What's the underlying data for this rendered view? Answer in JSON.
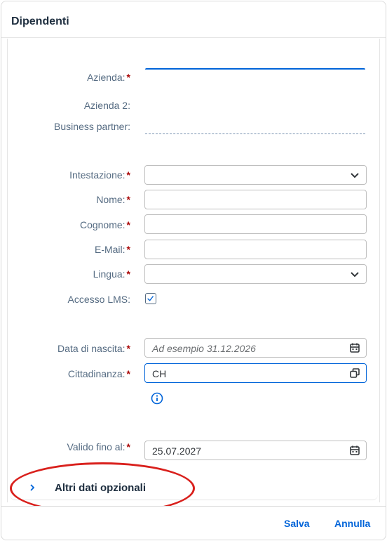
{
  "dialog": {
    "title": "Dipendenti"
  },
  "form": {
    "azienda": {
      "label": "Azienda:",
      "required": "*",
      "value": ""
    },
    "azienda2": {
      "label": "Azienda 2:",
      "value": ""
    },
    "business_partner": {
      "label": "Business partner:",
      "value": ""
    },
    "intestazione": {
      "label": "Intestazione:",
      "required": "*",
      "value": ""
    },
    "nome": {
      "label": "Nome:",
      "required": "*",
      "value": ""
    },
    "cognome": {
      "label": "Cognome:",
      "required": "*",
      "value": ""
    },
    "email": {
      "label": "E-Mail:",
      "required": "*",
      "value": ""
    },
    "lingua": {
      "label": "Lingua:",
      "required": "*",
      "value": ""
    },
    "accesso_lms": {
      "label": "Accesso LMS:",
      "checked": true
    },
    "data_nascita": {
      "label": "Data di nascita:",
      "required": "*",
      "placeholder": "Ad esempio 31.12.2026",
      "value": ""
    },
    "cittadinanza": {
      "label": "Cittadinanza:",
      "required": "*",
      "value": "CH"
    },
    "valido_fino": {
      "label": "Valido fino al:",
      "required": "*",
      "value": "25.07.2027"
    }
  },
  "optional_section": {
    "title": "Altri dati opzionali",
    "expanded": false
  },
  "footer": {
    "save_label": "Salva",
    "cancel_label": "Annulla"
  },
  "colors": {
    "accent": "#0064d9",
    "required": "#aa0808",
    "annotation": "#d9201c"
  },
  "icons": {
    "dropdown": "chevron-down-icon",
    "calendar": "calendar-icon",
    "value_help": "value-help-icon",
    "info": "info-icon",
    "expand": "chevron-right-icon",
    "check": "checkmark-icon"
  }
}
